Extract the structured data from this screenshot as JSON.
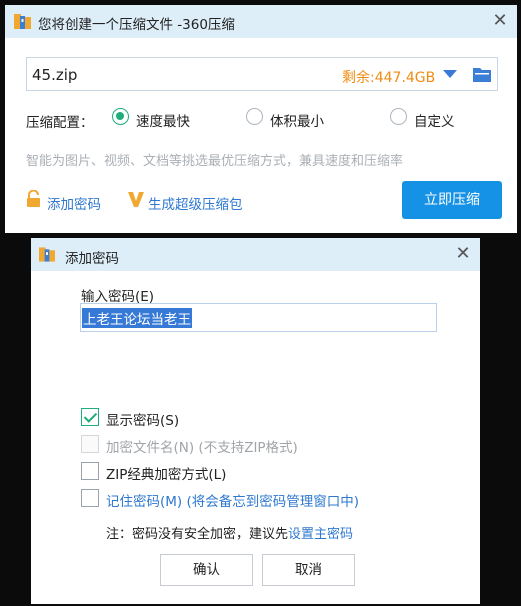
{
  "main_window": {
    "title": "您将创建一个压缩文件 -360压缩",
    "filename": "45.zip",
    "free_space": "剩余:447.4GB",
    "config_label": "压缩配置：",
    "options": [
      {
        "label": "速度最快",
        "selected": true
      },
      {
        "label": "体积最小",
        "selected": false
      },
      {
        "label": "自定义",
        "selected": false
      }
    ],
    "hint": "智能为图片、视频、文档等挑选最优压缩方式，兼具速度和压缩率",
    "add_password_link": "添加密码",
    "super_pack_link": "生成超级压缩包",
    "compress_button": "立即压缩"
  },
  "dialog": {
    "title": "添加密码",
    "input_label": "输入密码(E)",
    "password_value": "上老王论坛当老王",
    "checkboxes": [
      {
        "label": "显示密码(S)",
        "checked": true,
        "enabled": true
      },
      {
        "label": "加密文件名(N) (不支持ZIP格式)",
        "checked": false,
        "enabled": false
      },
      {
        "label": "ZIP经典加密方式(L)",
        "checked": false,
        "enabled": true
      },
      {
        "label": "记住密码(M) (将会备忘到密码管理窗口中)",
        "checked": false,
        "enabled": true
      }
    ],
    "note_prefix": "注：密码没有安全加密，建议先",
    "note_link": "设置主密码",
    "ok_button": "确认",
    "cancel_button": "取消"
  },
  "colors": {
    "accent": "#1592e6",
    "link": "#2e78d0",
    "free_space": "#f08c14",
    "selected": "#1fae7a",
    "titlebar": "#ddeef9"
  },
  "icons": [
    "app-icon",
    "close-icon",
    "dropdown-icon",
    "folder-icon",
    "lock-icon",
    "v-icon"
  ]
}
